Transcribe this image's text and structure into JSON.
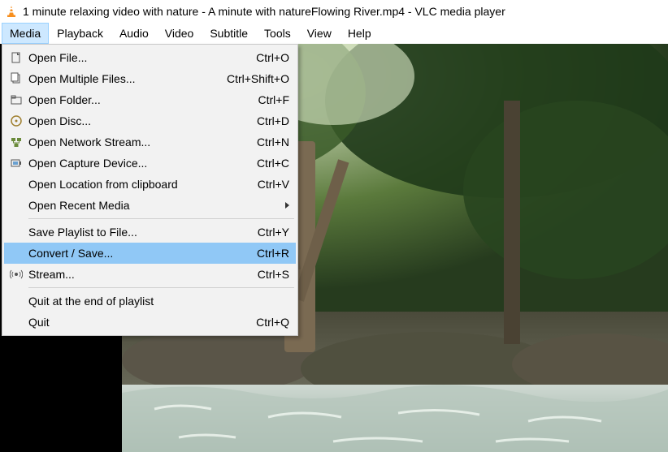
{
  "titlebar": {
    "text": "1 minute relaxing video with nature - A minute with natureFlowing River.mp4 - VLC media player"
  },
  "menubar": {
    "items": [
      {
        "label": "Media",
        "active": true
      },
      {
        "label": "Playback"
      },
      {
        "label": "Audio"
      },
      {
        "label": "Video"
      },
      {
        "label": "Subtitle"
      },
      {
        "label": "Tools"
      },
      {
        "label": "View"
      },
      {
        "label": "Help"
      }
    ]
  },
  "media_menu": {
    "groups": [
      [
        {
          "icon": "file-icon",
          "label": "Open File...",
          "shortcut": "Ctrl+O"
        },
        {
          "icon": "files-icon",
          "label": "Open Multiple Files...",
          "shortcut": "Ctrl+Shift+O"
        },
        {
          "icon": "folder-icon",
          "label": "Open Folder...",
          "shortcut": "Ctrl+F"
        },
        {
          "icon": "disc-icon",
          "label": "Open Disc...",
          "shortcut": "Ctrl+D"
        },
        {
          "icon": "network-icon",
          "label": "Open Network Stream...",
          "shortcut": "Ctrl+N"
        },
        {
          "icon": "capture-icon",
          "label": "Open Capture Device...",
          "shortcut": "Ctrl+C"
        },
        {
          "icon": "",
          "label": "Open Location from clipboard",
          "shortcut": "Ctrl+V"
        },
        {
          "icon": "",
          "label": "Open Recent Media",
          "submenu": true
        }
      ],
      [
        {
          "icon": "",
          "label": "Save Playlist to File...",
          "shortcut": "Ctrl+Y"
        },
        {
          "icon": "",
          "label": "Convert / Save...",
          "shortcut": "Ctrl+R",
          "highlight": true
        },
        {
          "icon": "stream-icon",
          "label": "Stream...",
          "shortcut": "Ctrl+S"
        }
      ],
      [
        {
          "icon": "",
          "label": "Quit at the end of playlist"
        },
        {
          "icon": "",
          "label": "Quit",
          "shortcut": "Ctrl+Q"
        }
      ]
    ]
  }
}
